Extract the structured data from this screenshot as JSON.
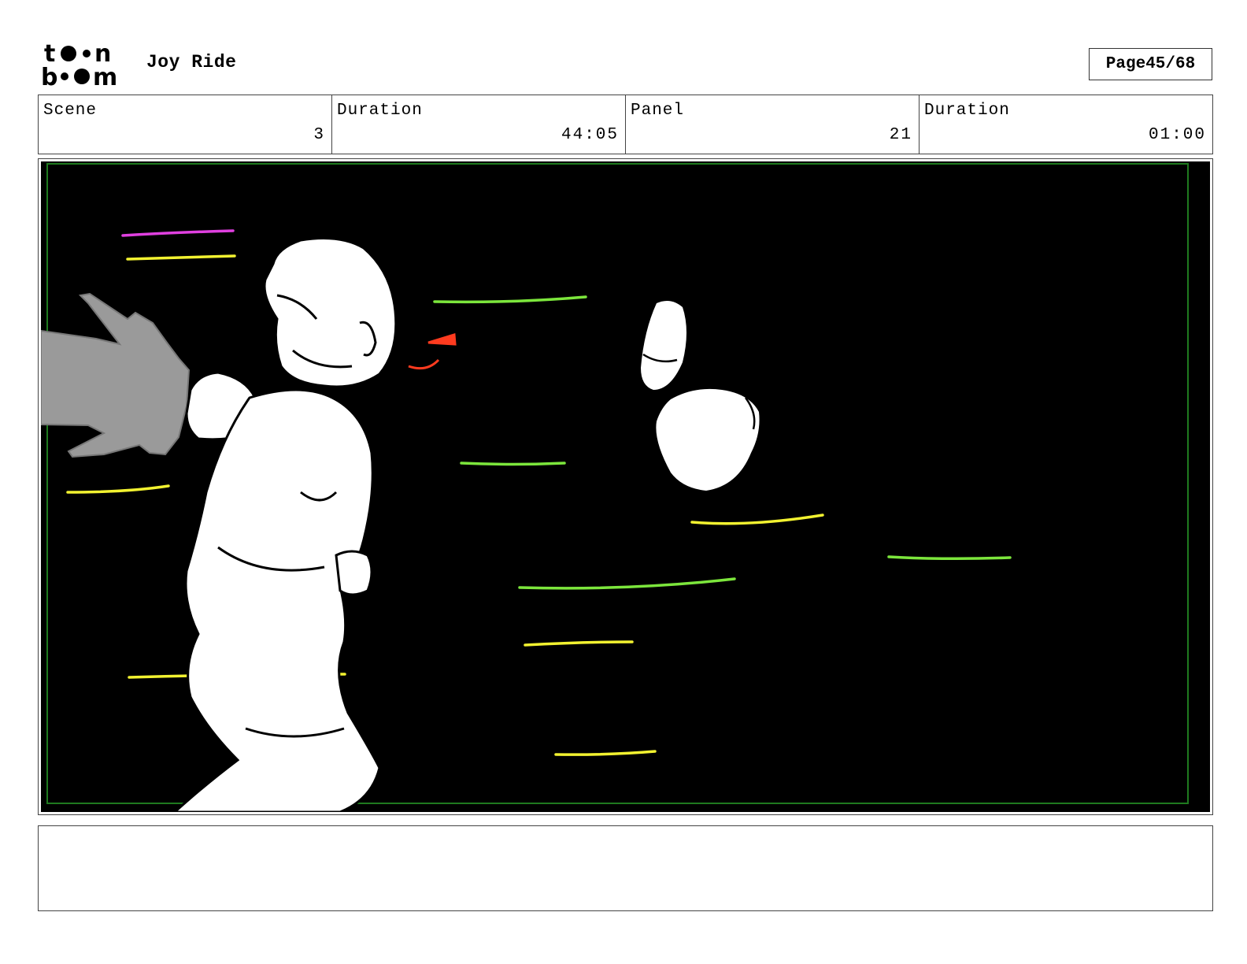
{
  "header": {
    "logo_text": "toon boom",
    "project_title": "Joy Ride",
    "page_label": "Page",
    "page_number": "45/68"
  },
  "info": {
    "scene_label": "Scene",
    "scene_value": "3",
    "scene_duration_label": "Duration",
    "scene_duration_value": "44:05",
    "panel_label": "Panel",
    "panel_value": "21",
    "panel_duration_label": "Duration",
    "panel_duration_value": "01:00"
  },
  "panel": {
    "background_color": "#000000",
    "safe_frame_color": "#1f7a1f",
    "speed_line_colors": [
      "#e040e0",
      "#f2f230",
      "#7ce63c"
    ],
    "accent_color": "#ff3b1f"
  },
  "notes": {
    "text": ""
  }
}
